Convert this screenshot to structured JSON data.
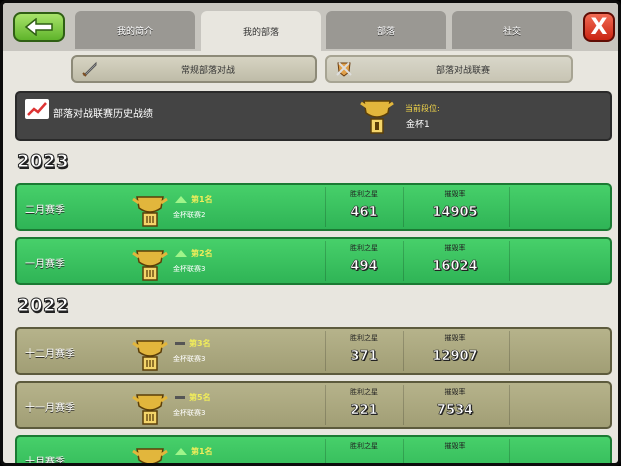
{
  "header": {
    "tabs": [
      {
        "label": "我的简介"
      },
      {
        "label": "我的部落"
      },
      {
        "label": "部落"
      },
      {
        "label": "社交"
      }
    ],
    "close_label": "X"
  },
  "subtabs": {
    "left": "常规部落对战",
    "right": "部落对战联赛"
  },
  "history": {
    "title": "部落对战联赛历史战绩",
    "current_label": "当前段位:",
    "current_value": "金杯1"
  },
  "groups": [
    {
      "year": "2023",
      "rows": [
        {
          "season": "二月赛季",
          "rank": "第1名",
          "trend": "up",
          "league": "金杯联赛2",
          "stars_label": "胜利之星",
          "stars": "461",
          "destruction_label": "摧毁率",
          "destruction": "14905",
          "color": "green"
        },
        {
          "season": "一月赛季",
          "rank": "第2名",
          "trend": "up",
          "league": "金杯联赛3",
          "stars_label": "胜利之星",
          "stars": "494",
          "destruction_label": "摧毁率",
          "destruction": "16024",
          "color": "green"
        }
      ]
    },
    {
      "year": "2022",
      "rows": [
        {
          "season": "十二月赛季",
          "rank": "第3名",
          "trend": "same",
          "league": "金杯联赛3",
          "stars_label": "胜利之星",
          "stars": "371",
          "destruction_label": "摧毁率",
          "destruction": "12907",
          "color": "olive"
        },
        {
          "season": "十一月赛季",
          "rank": "第5名",
          "trend": "same",
          "league": "金杯联赛3",
          "stars_label": "胜利之星",
          "stars": "221",
          "destruction_label": "摧毁率",
          "destruction": "7534",
          "color": "olive"
        },
        {
          "season": "十月赛季",
          "rank": "第1名",
          "trend": "up",
          "league": "",
          "stars_label": "胜利之星",
          "stars": "",
          "destruction_label": "摧毁率",
          "destruction": "",
          "color": "green"
        }
      ]
    }
  ],
  "colors": {
    "green_row": "#35bd5c",
    "olive_row": "#aba880",
    "history_bar": "#444444",
    "gold": "#f5d84a"
  }
}
